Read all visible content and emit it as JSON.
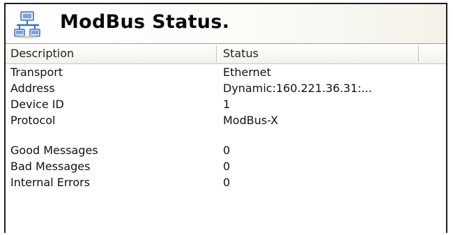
{
  "window": {
    "title": "ModBus Status.",
    "icon": "network-icon"
  },
  "columns": {
    "description": "Description",
    "status": "Status"
  },
  "rows": [
    {
      "label": "Transport",
      "value": "Ethernet"
    },
    {
      "label": "Address",
      "value": "Dynamic:160.221.36.31:..."
    },
    {
      "label": "Device ID",
      "value": "1"
    },
    {
      "label": "Protocol",
      "value": "ModBus-X"
    },
    {
      "label": "Good Messages",
      "value": "0"
    },
    {
      "label": "Bad Messages",
      "value": "0"
    },
    {
      "label": "Internal Errors",
      "value": "0"
    }
  ],
  "colors": {
    "border": "#1e1e1e",
    "icon_blue": "#3b6fc4"
  }
}
